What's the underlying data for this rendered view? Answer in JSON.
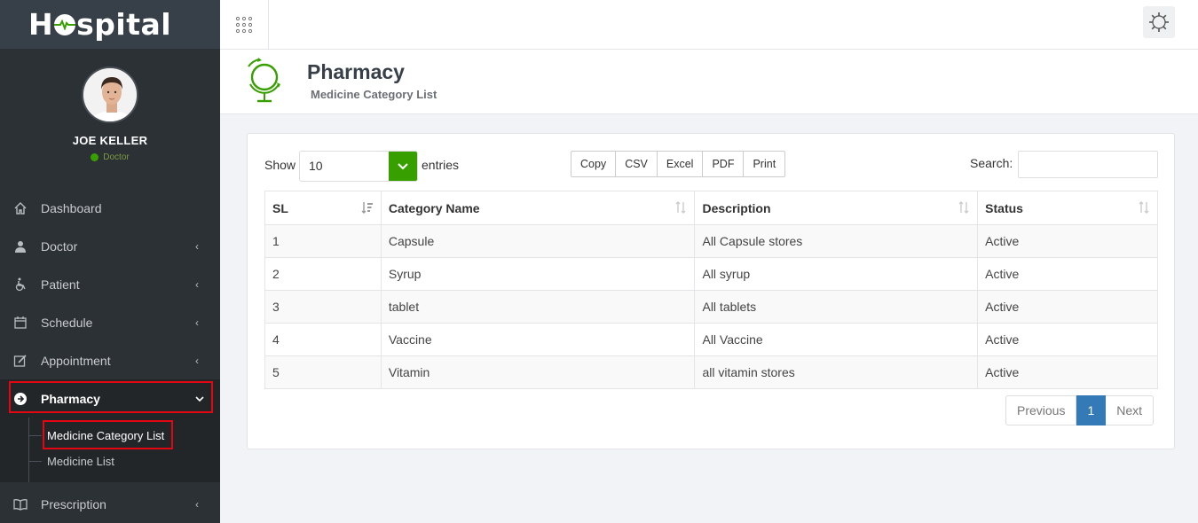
{
  "brand": {
    "logo_text_pre": "H",
    "logo_text_post": "spital"
  },
  "user": {
    "name": "JOE KELLER",
    "role": "Doctor"
  },
  "menu": {
    "items": [
      {
        "label": "Dashboard",
        "icon": "home-icon"
      },
      {
        "label": "Doctor",
        "icon": "user-md-icon"
      },
      {
        "label": "Patient",
        "icon": "wheelchair-icon"
      },
      {
        "label": "Schedule",
        "icon": "calendar-icon"
      },
      {
        "label": "Appointment",
        "icon": "edit-icon"
      },
      {
        "label": "Pharmacy",
        "icon": "arrow-circle-right-icon"
      },
      {
        "label": "Prescription",
        "icon": "book-icon"
      }
    ],
    "pharmacy_sub": [
      {
        "label": "Medicine Category List"
      },
      {
        "label": "Medicine List"
      }
    ]
  },
  "header": {
    "title": "Pharmacy",
    "subtitle": "Medicine Category List"
  },
  "table_controls": {
    "show_label": "Show",
    "length_value": "10",
    "entries_label": "entries",
    "buttons": [
      "Copy",
      "CSV",
      "Excel",
      "PDF",
      "Print"
    ],
    "search_label": "Search:",
    "search_value": ""
  },
  "table": {
    "columns": [
      "SL",
      "Category Name",
      "Description",
      "Status"
    ],
    "rows": [
      [
        "1",
        "Capsule",
        "All Capsule stores",
        "Active"
      ],
      [
        "2",
        "Syrup",
        "All syrup",
        "Active"
      ],
      [
        "3",
        "tablet",
        "All tablets",
        "Active"
      ],
      [
        "4",
        "Vaccine",
        "All Vaccine",
        "Active"
      ],
      [
        "5",
        "Vitamin",
        "all vitamin stores",
        "Active"
      ]
    ]
  },
  "pagination": {
    "previous": "Previous",
    "current": "1",
    "next": "Next"
  },
  "colors": {
    "accent": "#37a000",
    "sidebar": "#2c3136",
    "highlight": "#e30613",
    "page_active": "#337ab7"
  }
}
